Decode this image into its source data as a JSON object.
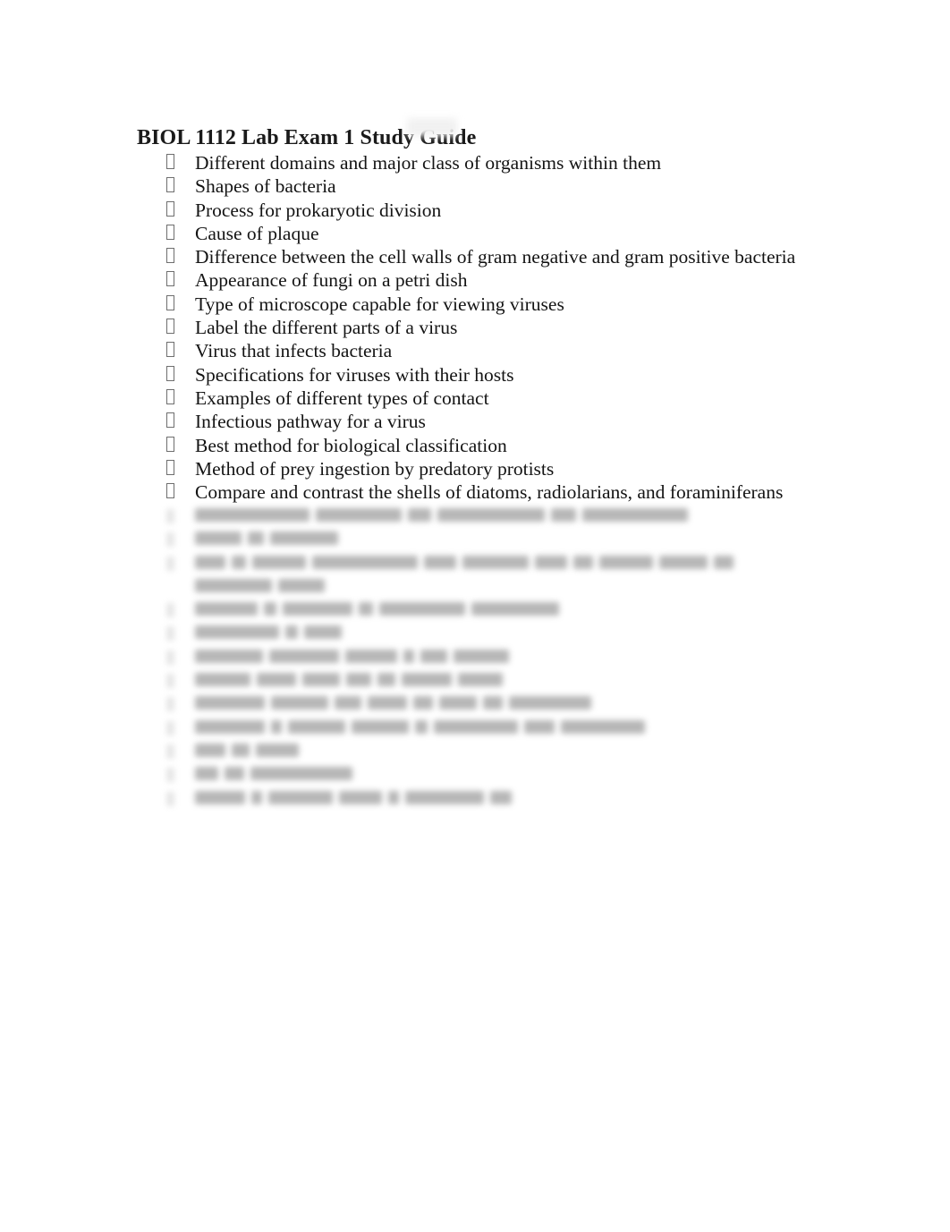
{
  "document": {
    "title": "BIOL 1112 Lab Exam 1 Study Guide",
    "background_color": "#ffffff",
    "text_color": "#141414",
    "bullet_glyph": "missing-glyph-box"
  },
  "study_guide": {
    "visible_items": [
      {
        "text": "Different domains and major class of organisms within them"
      },
      {
        "text": "Shapes of bacteria"
      },
      {
        "text": "Process for prokaryotic division"
      },
      {
        "text": "Cause of plaque"
      },
      {
        "text": "Difference between the cell walls of gram negative and gram positive bacteria"
      },
      {
        "text": "Appearance of fungi on a petri dish"
      },
      {
        "text": "Type of microscope capable for viewing viruses"
      },
      {
        "text": "Label the different parts of a virus"
      },
      {
        "text": "Virus that infects bacteria"
      },
      {
        "text": "Specifications for viruses with their hosts"
      },
      {
        "text": "Examples of different types of contact"
      },
      {
        "text": "Infectious pathway for a virus"
      },
      {
        "text": "Best method for biological classification"
      },
      {
        "text": "Method of prey ingestion by predatory protists"
      },
      {
        "text": "Compare and contrast the shells of diatoms, radiolarians, and foraminiferans"
      }
    ],
    "obscured_items": [
      {
        "indent": 218,
        "words": [
          128,
          96,
          26,
          120,
          28,
          118
        ],
        "bulleted": true
      },
      {
        "indent": 218,
        "words": [
          52,
          18,
          76
        ],
        "bulleted": true
      },
      {
        "indent": 218,
        "words": [
          34,
          16,
          60,
          118,
          36,
          74,
          36,
          22,
          60,
          54,
          22
        ],
        "bulleted": true
      },
      {
        "indent": 218,
        "words": [
          86,
          52
        ],
        "bulleted": false
      },
      {
        "indent": 218,
        "words": [
          70,
          14,
          78,
          16,
          96,
          98
        ],
        "bulleted": true
      },
      {
        "indent": 218,
        "words": [
          94,
          14,
          42
        ],
        "bulleted": true
      },
      {
        "indent": 218,
        "words": [
          76,
          78,
          58,
          12,
          30,
          62
        ],
        "bulleted": true
      },
      {
        "indent": 218,
        "words": [
          62,
          44,
          42,
          28,
          20,
          56,
          50
        ],
        "bulleted": true
      },
      {
        "indent": 218,
        "words": [
          78,
          64,
          30,
          44,
          22,
          42,
          22,
          92
        ],
        "bulleted": true
      },
      {
        "indent": 218,
        "words": [
          78,
          12,
          64,
          64,
          14,
          94,
          34,
          94
        ],
        "bulleted": true
      },
      {
        "indent": 218,
        "words": [
          34,
          20,
          48
        ],
        "bulleted": true
      },
      {
        "indent": 218,
        "words": [
          26,
          22,
          114
        ],
        "bulleted": true
      },
      {
        "indent": 218,
        "words": [
          56,
          12,
          72,
          48,
          12,
          88,
          24
        ],
        "bulleted": true
      }
    ]
  }
}
